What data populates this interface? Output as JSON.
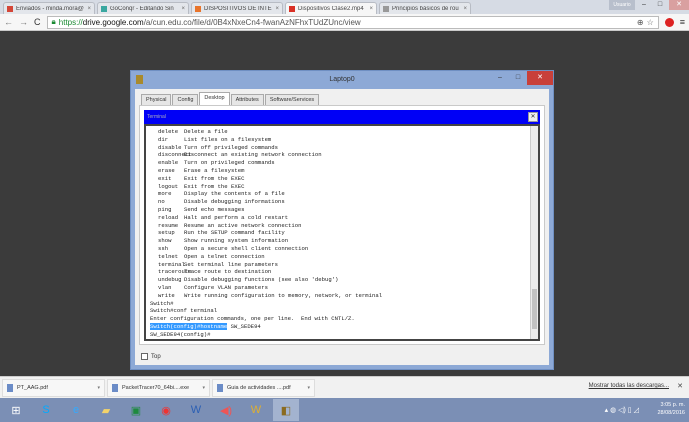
{
  "browser": {
    "tabs": [
      {
        "label": "Enviados - minda.mora@",
        "color": "#d44638"
      },
      {
        "label": "GoConqr - Editando Sin",
        "color": "#3aa7a0"
      },
      {
        "label": "DISPOSITIVOS DE INTERC",
        "color": "#e8742b"
      },
      {
        "label": "Dispositivos Clase2.mp4",
        "color": "#d93025",
        "active": true
      },
      {
        "label": "Principios básicos de rou",
        "color": "#999999"
      }
    ],
    "user_button": "Usuario",
    "url_scheme": "https://",
    "url_host": "drive.google.com",
    "url_path": "/a/cun.edu.co/file/d/0B4xNxeCn4-fwanAzNFhxTUdZUnc/view"
  },
  "laptop": {
    "title": "Laptop0",
    "tabs": [
      "Physical",
      "Config",
      "Desktop",
      "Attributes",
      "Software/Services"
    ],
    "active_tab": "Desktop",
    "terminal_title": "Terminal",
    "commands": [
      [
        "delete",
        "Delete a file"
      ],
      [
        "dir",
        "List files on a filesystem"
      ],
      [
        "disable",
        "Turn off privileged commands"
      ],
      [
        "disconnect",
        "Disconnect an existing network connection"
      ],
      [
        "enable",
        "Turn on privileged commands"
      ],
      [
        "erase",
        "Erase a filesystem"
      ],
      [
        "exit",
        "Exit from the EXEC"
      ],
      [
        "logout",
        "Exit from the EXEC"
      ],
      [
        "more",
        "Display the contents of a file"
      ],
      [
        "no",
        "Disable debugging informations"
      ],
      [
        "ping",
        "Send echo messages"
      ],
      [
        "reload",
        "Halt and perform a cold restart"
      ],
      [
        "resume",
        "Resume an active network connection"
      ],
      [
        "setup",
        "Run the SETUP command facility"
      ],
      [
        "show",
        "Show running system information"
      ],
      [
        "ssh",
        "Open a secure shell client connection"
      ],
      [
        "telnet",
        "Open a telnet connection"
      ],
      [
        "terminal",
        "Set terminal line parameters"
      ],
      [
        "traceroute",
        "Trace route to destination"
      ],
      [
        "undebug",
        "Disable debugging functions (see also 'debug')"
      ],
      [
        "vlan",
        "Configure VLAN parameters"
      ],
      [
        "write",
        "Write running configuration to memory, network, or terminal"
      ]
    ],
    "after": [
      "Switch#",
      "Switch#conf terminal",
      "Enter configuration commands, one per line.  End with CNTL/Z."
    ],
    "selected_prompt": "Switch(config)#hostname",
    "hostname_arg": " SW_SEDE94",
    "last_line": "SW_SEDE94(config)#",
    "top_label": "Top"
  },
  "downloads": {
    "items": [
      "PT_AAG.pdf",
      "PacketTracer70_64bi....exe",
      "Guia de actividades ....pdf"
    ],
    "show_all": "Mostrar todas las descargas..."
  },
  "taskbar": {
    "time": "3:05 p. m.",
    "date": "28/08/2016"
  }
}
